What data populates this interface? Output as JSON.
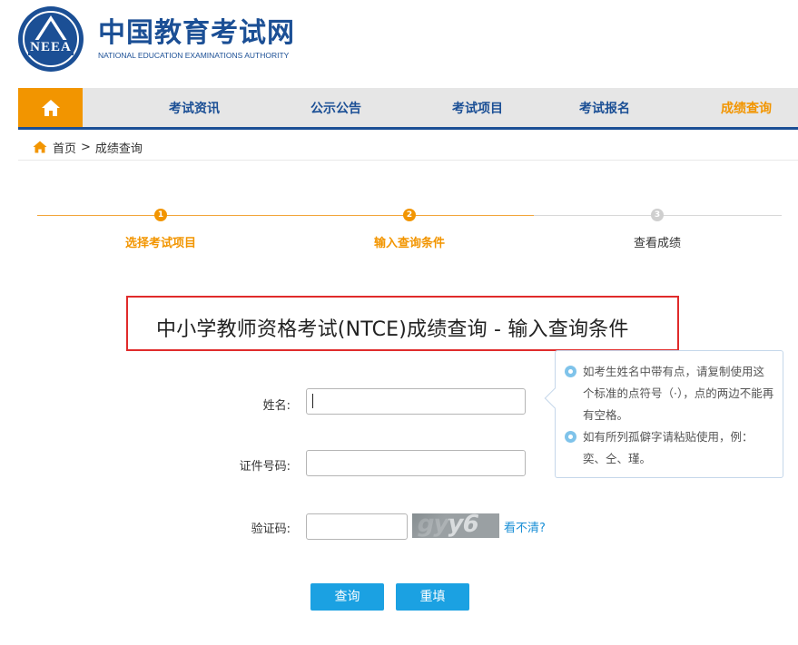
{
  "header": {
    "logo_abbr": "NEEA",
    "brand_cn": "中国教育考试网",
    "brand_en": "NATIONAL EDUCATION EXAMINATIONS AUTHORITY"
  },
  "nav": {
    "items": [
      {
        "label": "考试资讯"
      },
      {
        "label": "公示公告"
      },
      {
        "label": "考试项目"
      },
      {
        "label": "考试报名"
      },
      {
        "label": "成绩查询"
      }
    ],
    "active_color": "#f29500",
    "link_color": "#1b4f95"
  },
  "breadcrumb": {
    "home": "首页",
    "separator": ">",
    "current": "成绩查询"
  },
  "steps": [
    {
      "number": "1",
      "label": "选择考试项目",
      "state": "done"
    },
    {
      "number": "2",
      "label": "输入查询条件",
      "state": "current"
    },
    {
      "number": "3",
      "label": "查看成绩",
      "state": "pending"
    }
  ],
  "page_title": "中小学教师资格考试(NTCE)成绩查询 - 输入查询条件",
  "form": {
    "name_label": "姓名:",
    "name_value": "",
    "id_label": "证件号码:",
    "id_value": "",
    "captcha_label": "验证码:",
    "captcha_value": "",
    "captcha_text": "gyy6",
    "refresh_link": "看不清?"
  },
  "tips": [
    "如考生姓名中带有点，请复制使用这个标准的点符号（·），点的两边不能再有空格。",
    "如有所列孤僻字请粘贴使用，例：奕、仝、瑾。"
  ],
  "buttons": {
    "submit": "查询",
    "reset": "重填"
  },
  "colors": {
    "brand_blue": "#1b4f95",
    "orange": "#f29500",
    "button_blue": "#1ba1e2",
    "highlight_red": "#e02b2b"
  }
}
